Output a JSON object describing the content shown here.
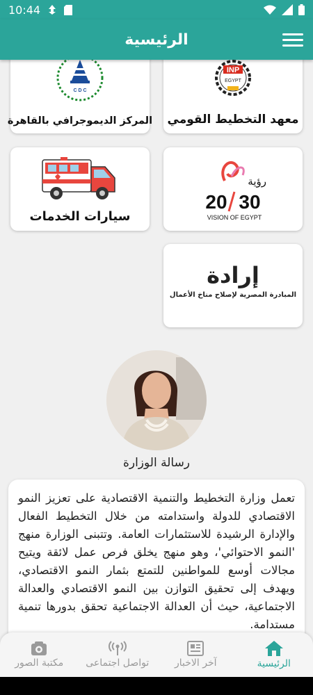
{
  "status_bar": {
    "time": "10:44"
  },
  "app_bar": {
    "title": "الرئيسية"
  },
  "cards": {
    "inp": {
      "label": "معهد التخطيط القومي",
      "logo_text": "INP",
      "logo_sub": "EGYPT"
    },
    "cdc": {
      "label": "المركز الديموجرافي بالقاهرة",
      "logo_text": "C D C"
    },
    "ambulance": {
      "label": "سيارات الخدمات"
    },
    "vision": {
      "label_top": "رؤية",
      "label_num_left": "20",
      "label_num_right": "30",
      "label_sub": "VISION OF EGYPT"
    },
    "erada": {
      "title": "إرادة",
      "subtitle": "المبادرة المصرية لإصلاح مناخ الأعمال"
    }
  },
  "minister": {
    "caption": "رسالة الوزارة",
    "message": "تعمل وزارة التخطيط والتنمية الاقتصادية على تعزيز النمو الاقتصادي للدولة واستدامته من خلال التخطيط الفعال والإدارة الرشيدة للاستثمارات العامة. وتتبنى الوزارة منهج 'النمو الاحتوائي'، وهو منهج يخلق فرص عمل لائقة ويتيح مجالات أوسع للمواطنين للتمتع بثمار النمو الاقتصادي، ويهدف إلى تحقيق التوازن بين النمو الاقتصادي والعدالة الاجتماعية، حيث أن العدالة الاجتماعية تحقق بدورها تنمية مستدامة."
  },
  "bottom_nav": {
    "home": "الرئيسية",
    "news": "آخر الاخبار",
    "social": "تواصل اجتماعى",
    "gallery": "مكتبة الصور"
  },
  "colors": {
    "accent": "#2ba59a",
    "inactive": "#9a9a9a"
  },
  "icons": [
    "menu-icon",
    "home-icon",
    "news-icon",
    "antenna-icon",
    "camera-icon",
    "wifi-icon",
    "battery-icon",
    "signal-icon"
  ]
}
